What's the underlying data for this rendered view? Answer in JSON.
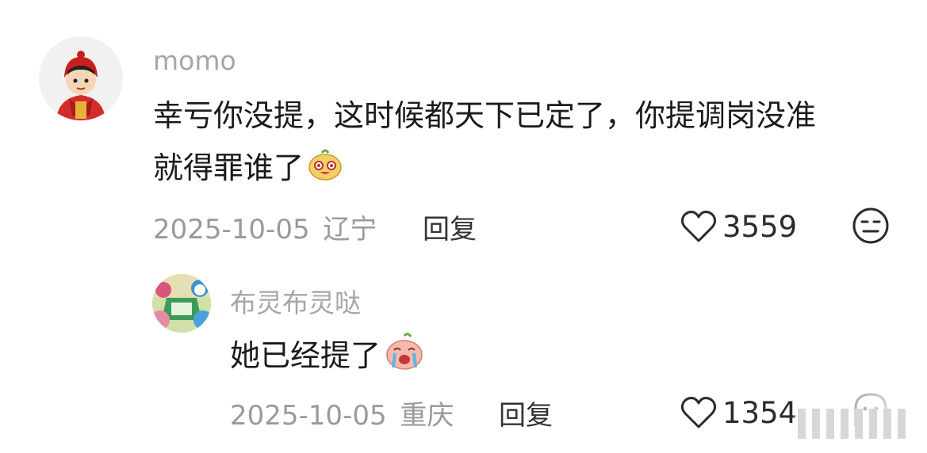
{
  "comment": {
    "username": "momo",
    "text_line1": "幸亏你没提，这时候都天下已定了，你提调岗没准",
    "text_line2": "就得罪谁了",
    "date": "2025-10-05",
    "location": "辽宁",
    "reply_label": "回复",
    "likes": "3559"
  },
  "reply": {
    "username": "布灵布灵哒",
    "text": "她已经提了",
    "date": "2025-10-05",
    "location": "重庆",
    "reply_label": "回复",
    "likes": "1354"
  },
  "icons": {
    "like": "heart-outline-icon",
    "reaction_main": "meh-face-icon",
    "reaction_reply": "ghost-face-icon",
    "emoji_main": "excited-dog-emoji",
    "emoji_reply": "crying-peach-emoji"
  }
}
